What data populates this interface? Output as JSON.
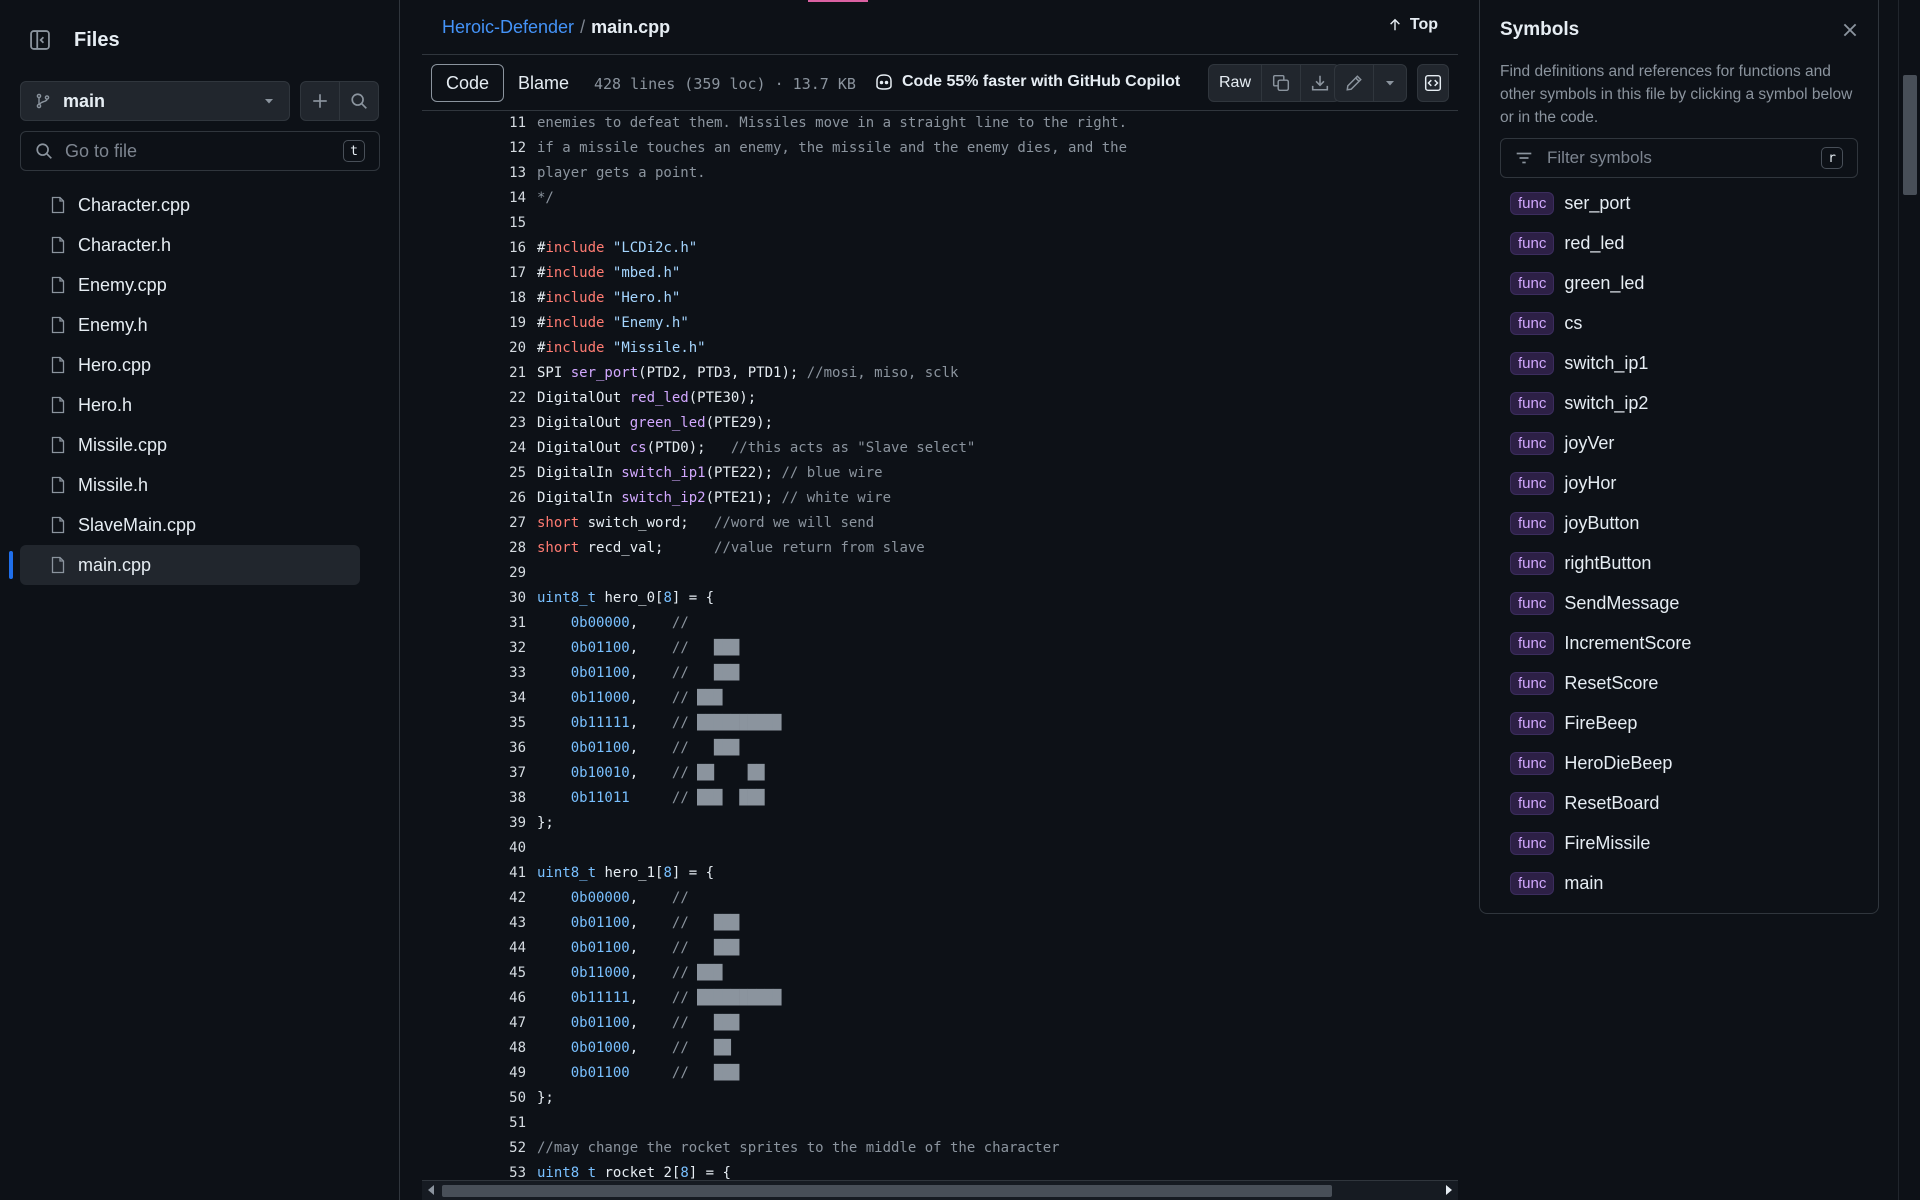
{
  "file_tree": {
    "title": "Files",
    "branch": "main",
    "goto_placeholder": "Go to file",
    "goto_shortcut": "t",
    "files": [
      {
        "name": "Character.cpp",
        "active": false
      },
      {
        "name": "Character.h",
        "active": false
      },
      {
        "name": "Enemy.cpp",
        "active": false
      },
      {
        "name": "Enemy.h",
        "active": false
      },
      {
        "name": "Hero.cpp",
        "active": false
      },
      {
        "name": "Hero.h",
        "active": false
      },
      {
        "name": "Missile.cpp",
        "active": false
      },
      {
        "name": "Missile.h",
        "active": false
      },
      {
        "name": "SlaveMain.cpp",
        "active": false
      },
      {
        "name": "main.cpp",
        "active": true
      }
    ]
  },
  "header": {
    "repo": "Heroic-Defender",
    "separator": "/",
    "file": "main.cpp",
    "top_label": "Top"
  },
  "toolbar": {
    "code_label": "Code",
    "blame_label": "Blame",
    "meta": "428 lines (359 loc) · 13.7 KB",
    "copilot_text": "Code 55% faster with GitHub Copilot",
    "raw_label": "Raw"
  },
  "code": {
    "lines": [
      {
        "n": "11",
        "t": [
          [
            "cm",
            "enemies to defeat them. Missiles move in a straight line to the right."
          ]
        ]
      },
      {
        "n": "12",
        "t": [
          [
            "cm",
            "if a missile touches an enemy, the missile and the enemy dies, and the"
          ]
        ]
      },
      {
        "n": "13",
        "t": [
          [
            "cm",
            "player gets a point."
          ]
        ]
      },
      {
        "n": "14",
        "t": [
          [
            "cm",
            "*/"
          ]
        ]
      },
      {
        "n": "15",
        "t": []
      },
      {
        "n": "16",
        "t": [
          [
            "",
            "#"
          ],
          [
            "kw",
            "include"
          ],
          [
            "",
            " "
          ],
          [
            "str",
            "\"LCDi2c.h\""
          ]
        ]
      },
      {
        "n": "17",
        "t": [
          [
            "",
            "#"
          ],
          [
            "kw",
            "include"
          ],
          [
            "",
            " "
          ],
          [
            "str",
            "\"mbed.h\""
          ]
        ]
      },
      {
        "n": "18",
        "t": [
          [
            "",
            "#"
          ],
          [
            "kw",
            "include"
          ],
          [
            "",
            " "
          ],
          [
            "str",
            "\"Hero.h\""
          ]
        ]
      },
      {
        "n": "19",
        "t": [
          [
            "",
            "#"
          ],
          [
            "kw",
            "include"
          ],
          [
            "",
            " "
          ],
          [
            "str",
            "\"Enemy.h\""
          ]
        ]
      },
      {
        "n": "20",
        "t": [
          [
            "",
            "#"
          ],
          [
            "kw",
            "include"
          ],
          [
            "",
            " "
          ],
          [
            "str",
            "\"Missile.h\""
          ]
        ]
      },
      {
        "n": "21",
        "t": [
          [
            "",
            "SPI "
          ],
          [
            "fn",
            "ser_port"
          ],
          [
            "",
            "(PTD2, PTD3, PTD1); "
          ],
          [
            "cm",
            "//mosi, miso, sclk"
          ]
        ]
      },
      {
        "n": "22",
        "t": [
          [
            "",
            "DigitalOut "
          ],
          [
            "fn",
            "red_led"
          ],
          [
            "",
            "(PTE30);"
          ]
        ]
      },
      {
        "n": "23",
        "t": [
          [
            "",
            "DigitalOut "
          ],
          [
            "fn",
            "green_led"
          ],
          [
            "",
            "(PTE29);"
          ]
        ]
      },
      {
        "n": "24",
        "t": [
          [
            "",
            "DigitalOut "
          ],
          [
            "fn",
            "cs"
          ],
          [
            "",
            "(PTD0);   "
          ],
          [
            "cm",
            "//this acts as \"Slave select\""
          ]
        ]
      },
      {
        "n": "25",
        "t": [
          [
            "",
            "DigitalIn "
          ],
          [
            "fn",
            "switch_ip1"
          ],
          [
            "",
            "(PTE22); "
          ],
          [
            "cm",
            "// blue wire"
          ]
        ]
      },
      {
        "n": "26",
        "t": [
          [
            "",
            "DigitalIn "
          ],
          [
            "fn",
            "switch_ip2"
          ],
          [
            "",
            "(PTE21); "
          ],
          [
            "cm",
            "// white wire"
          ]
        ]
      },
      {
        "n": "27",
        "t": [
          [
            "kw",
            "short"
          ],
          [
            "",
            " switch_word;   "
          ],
          [
            "cm",
            "//word we will send"
          ]
        ]
      },
      {
        "n": "28",
        "t": [
          [
            "kw",
            "short"
          ],
          [
            "",
            " recd_val;      "
          ],
          [
            "cm",
            "//value return from slave"
          ]
        ]
      },
      {
        "n": "29",
        "t": []
      },
      {
        "n": "30",
        "t": [
          [
            "ty",
            "uint8_t"
          ],
          [
            "",
            " hero_0["
          ],
          [
            "num",
            "8"
          ],
          [
            "",
            "] = {"
          ]
        ]
      },
      {
        "n": "31",
        "t": [
          [
            "",
            "    "
          ],
          [
            "num",
            "0b00000"
          ],
          [
            "",
            ",    "
          ],
          [
            "cm",
            "//"
          ]
        ]
      },
      {
        "n": "32",
        "t": [
          [
            "",
            "    "
          ],
          [
            "num",
            "0b01100"
          ],
          [
            "",
            ",    "
          ],
          [
            "cm",
            "//   ███"
          ]
        ]
      },
      {
        "n": "33",
        "t": [
          [
            "",
            "    "
          ],
          [
            "num",
            "0b01100"
          ],
          [
            "",
            ",    "
          ],
          [
            "cm",
            "//   ███"
          ]
        ]
      },
      {
        "n": "34",
        "t": [
          [
            "",
            "    "
          ],
          [
            "num",
            "0b11000"
          ],
          [
            "",
            ",    "
          ],
          [
            "cm",
            "// ███"
          ]
        ]
      },
      {
        "n": "35",
        "t": [
          [
            "",
            "    "
          ],
          [
            "num",
            "0b11111"
          ],
          [
            "",
            ",    "
          ],
          [
            "cm",
            "// ██████████"
          ]
        ]
      },
      {
        "n": "36",
        "t": [
          [
            "",
            "    "
          ],
          [
            "num",
            "0b01100"
          ],
          [
            "",
            ",    "
          ],
          [
            "cm",
            "//   ███"
          ]
        ]
      },
      {
        "n": "37",
        "t": [
          [
            "",
            "    "
          ],
          [
            "num",
            "0b10010"
          ],
          [
            "",
            ",    "
          ],
          [
            "cm",
            "// ██    ██"
          ]
        ]
      },
      {
        "n": "38",
        "t": [
          [
            "",
            "    "
          ],
          [
            "num",
            "0b11011"
          ],
          [
            "",
            "     "
          ],
          [
            "cm",
            "// ███  ███"
          ]
        ]
      },
      {
        "n": "39",
        "t": [
          [
            "",
            "};"
          ]
        ]
      },
      {
        "n": "40",
        "t": []
      },
      {
        "n": "41",
        "t": [
          [
            "ty",
            "uint8_t"
          ],
          [
            "",
            " hero_1["
          ],
          [
            "num",
            "8"
          ],
          [
            "",
            "] = {"
          ]
        ]
      },
      {
        "n": "42",
        "t": [
          [
            "",
            "    "
          ],
          [
            "num",
            "0b00000"
          ],
          [
            "",
            ",    "
          ],
          [
            "cm",
            "//"
          ]
        ]
      },
      {
        "n": "43",
        "t": [
          [
            "",
            "    "
          ],
          [
            "num",
            "0b01100"
          ],
          [
            "",
            ",    "
          ],
          [
            "cm",
            "//   ███"
          ]
        ]
      },
      {
        "n": "44",
        "t": [
          [
            "",
            "    "
          ],
          [
            "num",
            "0b01100"
          ],
          [
            "",
            ",    "
          ],
          [
            "cm",
            "//   ███"
          ]
        ]
      },
      {
        "n": "45",
        "t": [
          [
            "",
            "    "
          ],
          [
            "num",
            "0b11000"
          ],
          [
            "",
            ",    "
          ],
          [
            "cm",
            "// ███"
          ]
        ]
      },
      {
        "n": "46",
        "t": [
          [
            "",
            "    "
          ],
          [
            "num",
            "0b11111"
          ],
          [
            "",
            ",    "
          ],
          [
            "cm",
            "// ██████████"
          ]
        ]
      },
      {
        "n": "47",
        "t": [
          [
            "",
            "    "
          ],
          [
            "num",
            "0b01100"
          ],
          [
            "",
            ",    "
          ],
          [
            "cm",
            "//   ███"
          ]
        ]
      },
      {
        "n": "48",
        "t": [
          [
            "",
            "    "
          ],
          [
            "num",
            "0b01000"
          ],
          [
            "",
            ",    "
          ],
          [
            "cm",
            "//   ██"
          ]
        ]
      },
      {
        "n": "49",
        "t": [
          [
            "",
            "    "
          ],
          [
            "num",
            "0b01100"
          ],
          [
            "",
            "     "
          ],
          [
            "cm",
            "//   ███"
          ]
        ]
      },
      {
        "n": "50",
        "t": [
          [
            "",
            "};"
          ]
        ]
      },
      {
        "n": "51",
        "t": []
      },
      {
        "n": "52",
        "t": [
          [
            "cm",
            "//may change the rocket sprites to the middle of the character"
          ]
        ]
      },
      {
        "n": "53",
        "t": [
          [
            "ty",
            "uint8_t"
          ],
          [
            "",
            " rocket_2["
          ],
          [
            "num",
            "8"
          ],
          [
            "",
            "] = {"
          ]
        ]
      }
    ]
  },
  "symbols": {
    "title": "Symbols",
    "description": "Find definitions and references for functions and other symbols in this file by clicking a symbol below or in the code.",
    "filter_placeholder": "Filter symbols",
    "filter_shortcut": "r",
    "items": [
      {
        "kind": "func",
        "name": "ser_port"
      },
      {
        "kind": "func",
        "name": "red_led"
      },
      {
        "kind": "func",
        "name": "green_led"
      },
      {
        "kind": "func",
        "name": "cs"
      },
      {
        "kind": "func",
        "name": "switch_ip1"
      },
      {
        "kind": "func",
        "name": "switch_ip2"
      },
      {
        "kind": "func",
        "name": "joyVer"
      },
      {
        "kind": "func",
        "name": "joyHor"
      },
      {
        "kind": "func",
        "name": "joyButton"
      },
      {
        "kind": "func",
        "name": "rightButton"
      },
      {
        "kind": "func",
        "name": "SendMessage"
      },
      {
        "kind": "func",
        "name": "IncrementScore"
      },
      {
        "kind": "func",
        "name": "ResetScore"
      },
      {
        "kind": "func",
        "name": "FireBeep"
      },
      {
        "kind": "func",
        "name": "HeroDieBeep"
      },
      {
        "kind": "func",
        "name": "ResetBoard"
      },
      {
        "kind": "func",
        "name": "FireMissile"
      },
      {
        "kind": "func",
        "name": "main"
      }
    ]
  },
  "colors": {
    "background": "#0d1117",
    "accent_link": "#4493f8",
    "active_indicator": "#1f6feb",
    "func_badge": "#d2a8ff"
  }
}
